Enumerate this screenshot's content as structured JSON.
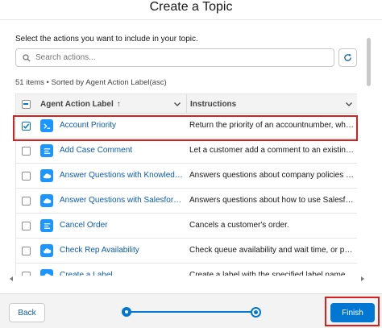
{
  "modal": {
    "title": "Create a Topic",
    "instructions": "Select the actions you want to include in your topic."
  },
  "search": {
    "placeholder": "Search actions...",
    "value": ""
  },
  "list_meta": "51 items • Sorted by Agent Action Label(asc)",
  "table": {
    "columns": [
      {
        "label": "Agent Action Label",
        "sort_indicator": "↑"
      },
      {
        "label": "Instructions"
      }
    ],
    "rows": [
      {
        "label": "Account Priority",
        "instructions": "Return the priority of an accountnumber, whe...",
        "checked": true,
        "icon": "terminal-icon"
      },
      {
        "label": "Add Case Comment",
        "instructions": "Let a customer add a comment to an existing...",
        "checked": false,
        "icon": "flow-icon"
      },
      {
        "label": "Answer Questions with Knowledge",
        "instructions": "Answers questions about company policies a...",
        "checked": false,
        "icon": "cloud-icon"
      },
      {
        "label": "Answer Questions with Salesforce...",
        "instructions": "Answers questions about how to use Salesfor...",
        "checked": false,
        "icon": "cloud-icon"
      },
      {
        "label": "Cancel Order",
        "instructions": "Cancels a customer's order.",
        "checked": false,
        "icon": "flow-icon"
      },
      {
        "label": "Check Rep Availability",
        "instructions": "Check queue availability and wait time, or provi...",
        "checked": false,
        "icon": "cloud-icon"
      },
      {
        "label": "Create a Label",
        "instructions": "Create a label with the specified label name.",
        "checked": false,
        "icon": "cloud-icon"
      }
    ]
  },
  "footer": {
    "back_label": "Back",
    "finish_label": "Finish",
    "current_step": 2,
    "total_steps": 2
  },
  "colors": {
    "brand": "#0176d3",
    "link": "#0b5cab",
    "highlight": "#d61f1f"
  }
}
